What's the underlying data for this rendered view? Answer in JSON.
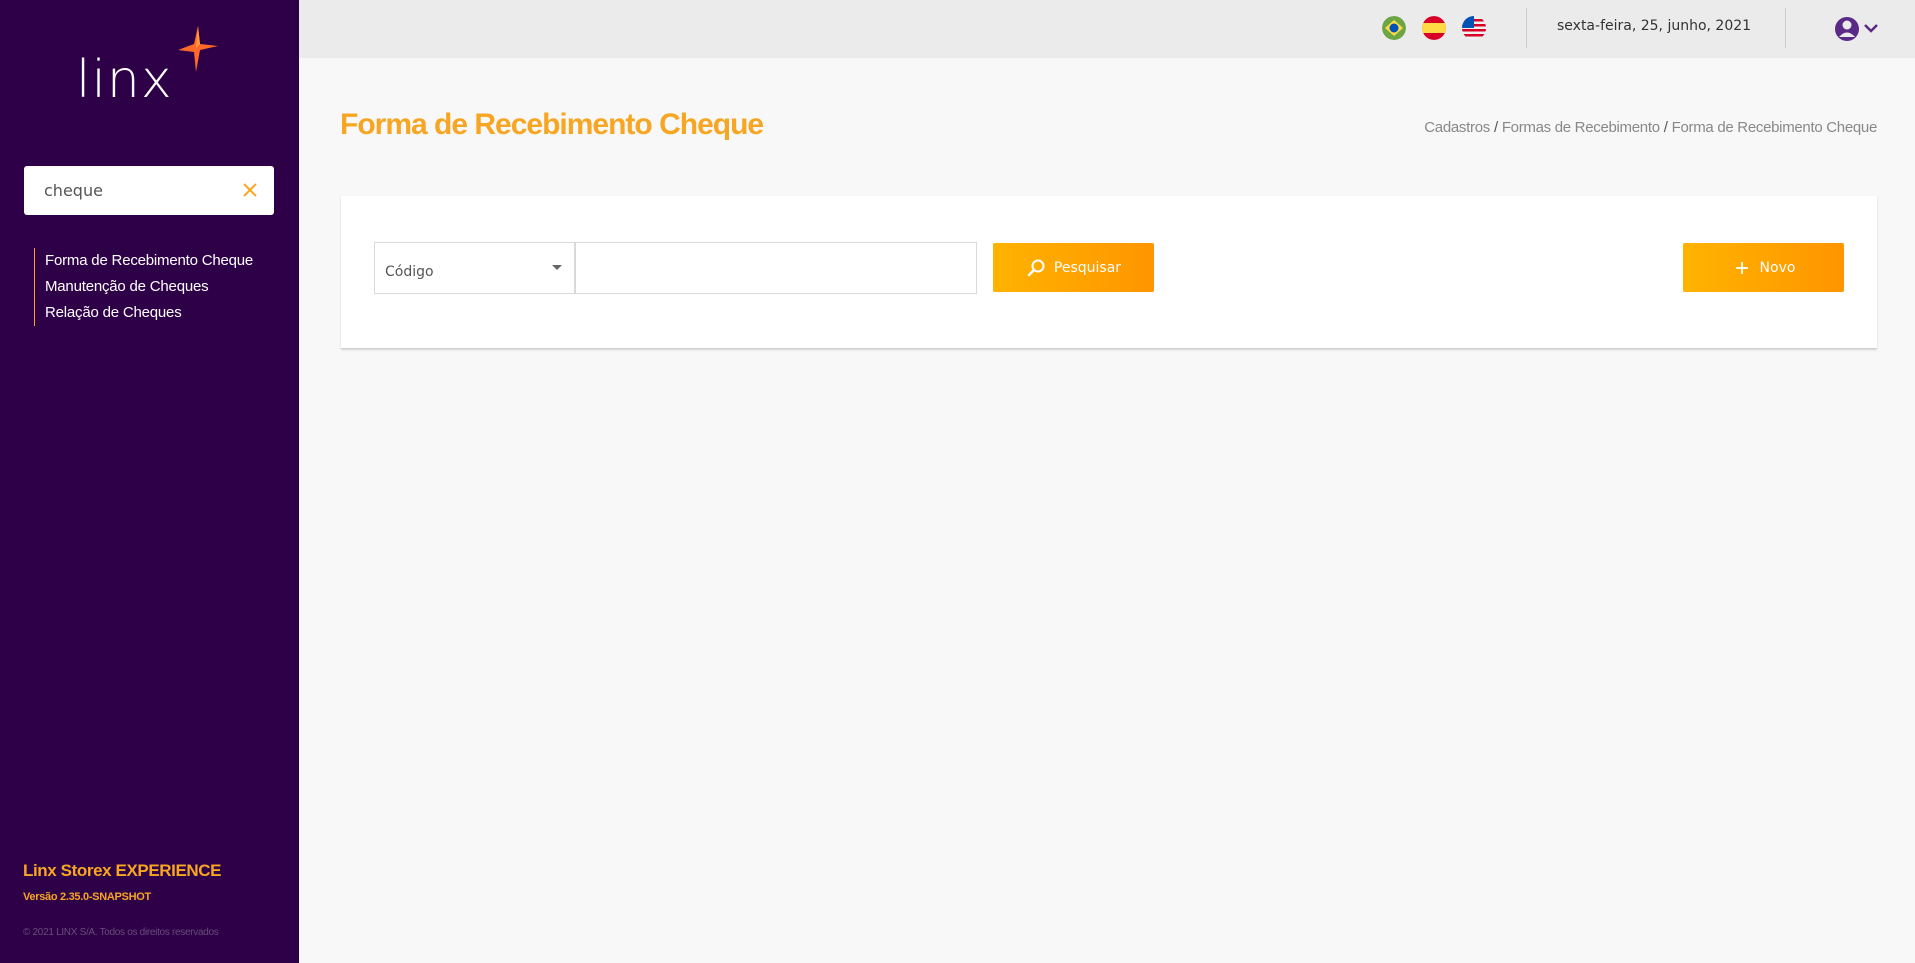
{
  "sidebar": {
    "logo_text": "linx",
    "search": {
      "value": "cheque",
      "placeholder": ""
    },
    "menu_items": [
      {
        "label": "Forma de Recebimento Cheque"
      },
      {
        "label": "Manutenção de Cheques"
      },
      {
        "label": "Relação de Cheques"
      }
    ],
    "footer": {
      "brand": "Linx Storex EXPERIENCE",
      "version": "Versão 2.35.0-SNAPSHOT",
      "copyright": "© 2021 LINX S/A. Todos os direitos reservados"
    }
  },
  "topbar": {
    "languages": [
      {
        "icon": "flag-brazil-icon"
      },
      {
        "icon": "flag-spain-icon"
      },
      {
        "icon": "flag-usa-icon"
      }
    ],
    "date": "sexta-feira, 25, junho, 2021",
    "user_icon": "user-circle-icon"
  },
  "main": {
    "title": "Forma de Recebimento Cheque",
    "breadcrumb": [
      "Cadastros",
      "Formas de Recebimento",
      "Forma de Recebimento Cheque"
    ],
    "filter": {
      "field_selected": "Código",
      "value": "",
      "search_label": "Pesquisar",
      "new_label": "Novo"
    }
  },
  "colors": {
    "sidebar_bg": "#2d0047",
    "accent": "#f7a623",
    "button_gradient_start": "#ffb300",
    "button_gradient_end": "#ff9500",
    "topbar_bg": "#ebebeb",
    "page_bg": "#f8f8f8"
  }
}
